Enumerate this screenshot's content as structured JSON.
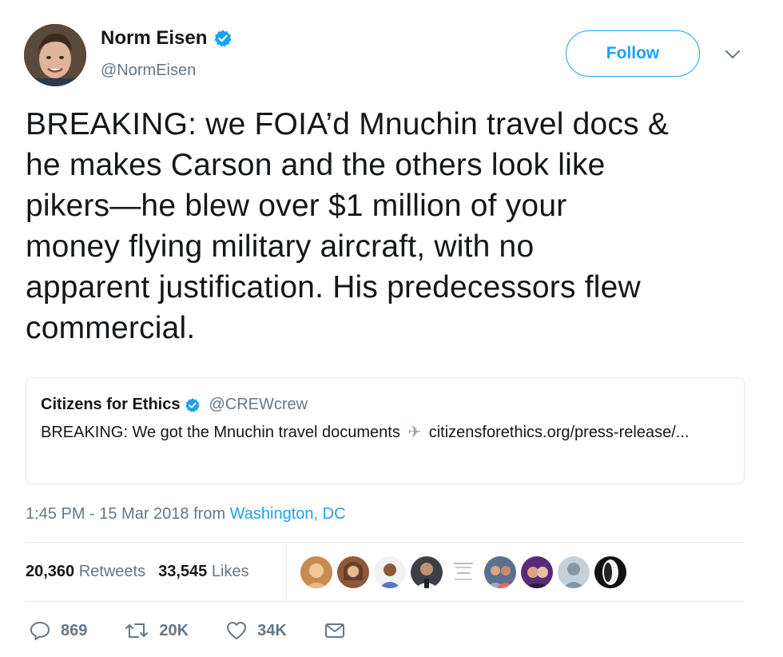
{
  "author": {
    "display_name": "Norm Eisen",
    "handle": "@NormEisen"
  },
  "follow_label": "Follow",
  "tweet": {
    "text": "BREAKING: we FOIA’d Mnuchin travel docs &\nhe makes Carson and the others look like\npikers—he blew over $1 million of your\nmoney flying military aircraft, with no\napparent justification. His predecessors flew\ncommercial."
  },
  "quote": {
    "name": "Citizens for Ethics",
    "handle": "@CREWcrew",
    "text_before": "BREAKING: We got the Mnuchin travel documents",
    "text_after": "citizensforethics.org/press-release/..."
  },
  "meta": {
    "time": "1:45 PM - 15 Mar 2018 from ",
    "location": "Washington, DC"
  },
  "stats": {
    "retweets_count": "20,360",
    "retweets_label": "Retweets",
    "likes_count": "33,545",
    "likes_label": "Likes"
  },
  "actions": {
    "replies": "869",
    "retweets": "20K",
    "likes": "34K"
  },
  "colors": {
    "accent": "#1da1f2",
    "muted": "#657786",
    "text": "#14171a"
  }
}
